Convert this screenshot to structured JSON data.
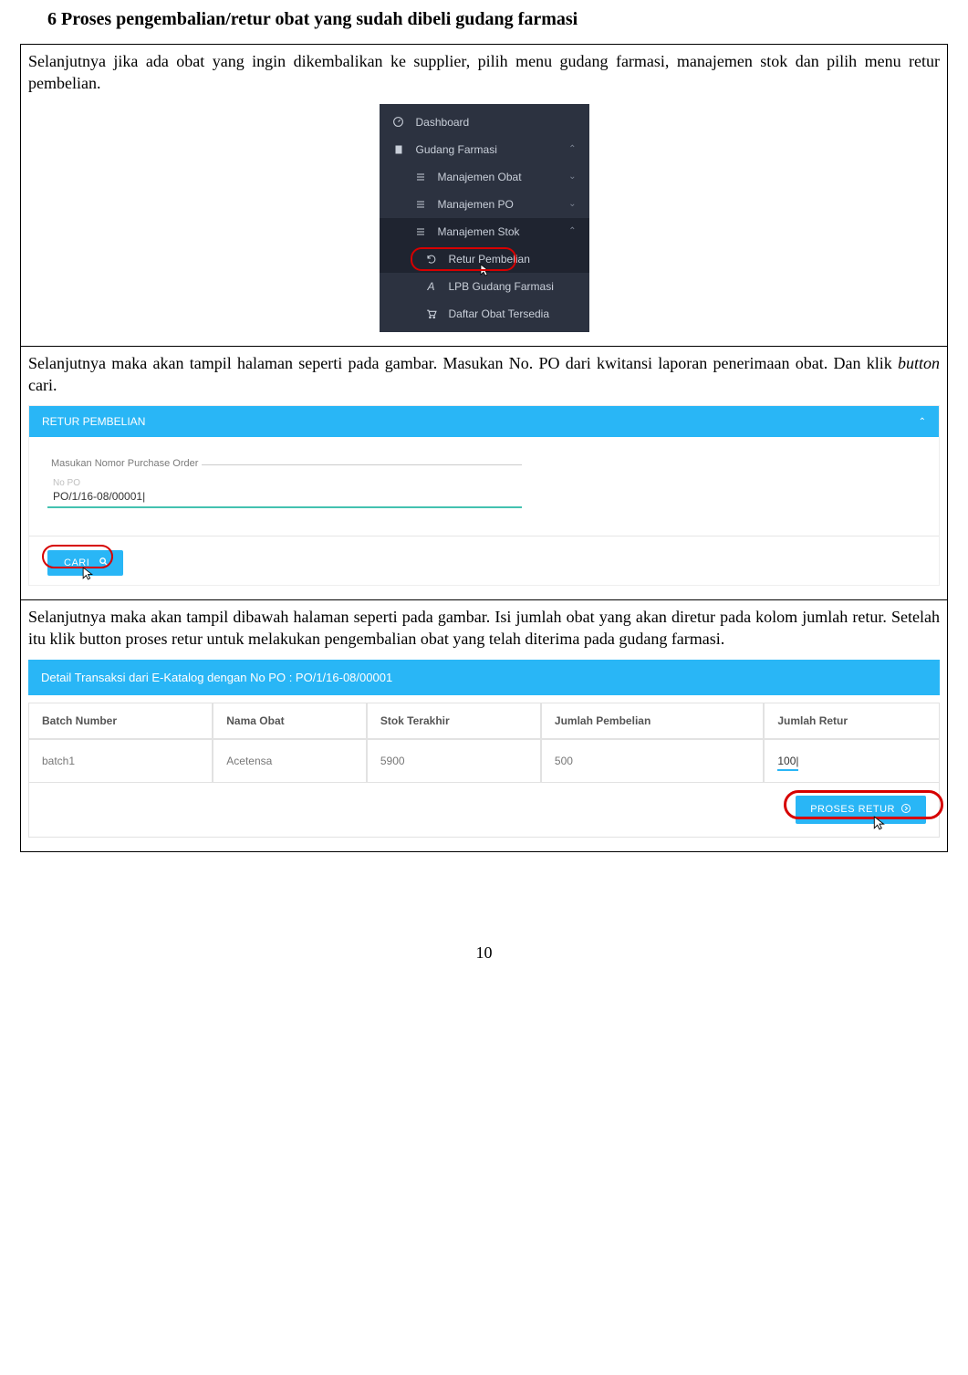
{
  "heading": "6   Proses pengembalian/retur obat yang sudah dibeli gudang farmasi",
  "step1": {
    "para_a": "Selanjutnya jika ada obat yang ingin dikembalikan ke supplier, pilih menu gudang farmasi, manajemen stok dan pilih menu retur pembelian.",
    "sidebar": {
      "dashboard": "Dashboard",
      "gudang": "Gudang Farmasi",
      "mobat": "Manajemen Obat",
      "mpo": "Manajemen PO",
      "mstok": "Manajemen Stok",
      "retur": "Retur Pembelian",
      "lpb": "LPB Gudang Farmasi",
      "daftar": "Daftar Obat Tersedia"
    }
  },
  "step2": {
    "para_a": "Selanjutnya maka akan tampil halaman seperti pada gambar. Masukan No. PO dari kwitansi laporan penerimaan obat. Dan klik ",
    "para_b": "button",
    "para_c": " cari.",
    "panel_title": "RETUR PEMBELIAN",
    "legend": "Masukan Nomor Purchase Order",
    "nopo_label": "No PO",
    "po_value": "PO/1/16-08/00001|",
    "btn_cari": "CARI"
  },
  "step3": {
    "para": "Selanjutnya maka akan tampil dibawah halaman seperti pada gambar. Isi jumlah obat yang akan diretur pada kolom jumlah retur. Setelah itu klik button proses retur untuk melakukan pengembalian obat yang telah diterima pada gudang farmasi.",
    "header": "Detail Transaksi dari E-Katalog dengan No PO : PO/1/16-08/00001",
    "cols": {
      "batch": "Batch Number",
      "nama": "Nama Obat",
      "stok": "Stok Terakhir",
      "jml": "Jumlah Pembelian",
      "retur": "Jumlah Retur"
    },
    "row": {
      "batch": "batch1",
      "nama": "Acetensa",
      "stok": "5900",
      "jml": "500",
      "retur": "100|"
    },
    "btn": "PROSES RETUR"
  },
  "pagenum": "10"
}
